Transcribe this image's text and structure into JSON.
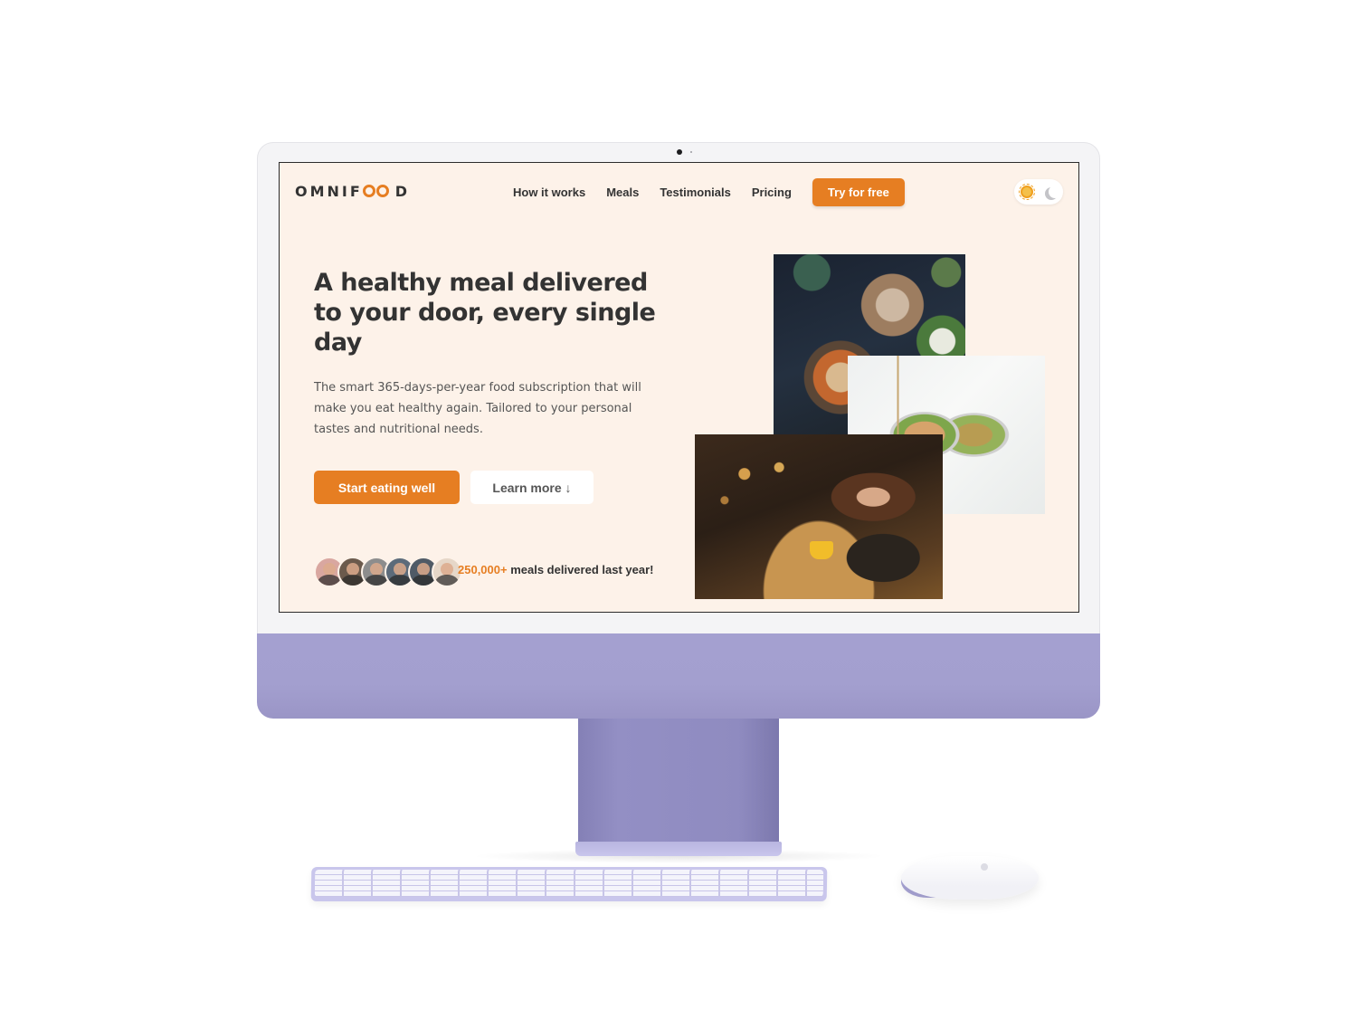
{
  "brand": {
    "logo_prefix": "OMNIF",
    "logo_suffix": "D",
    "accent_color": "#e67e22"
  },
  "nav": {
    "links": [
      "How it works",
      "Meals",
      "Testimonials",
      "Pricing"
    ],
    "cta": "Try for free"
  },
  "theme_toggle": {
    "light_icon": "sun-icon",
    "dark_icon": "moon-icon"
  },
  "hero": {
    "title": "A healthy meal delivered to your door, every single day",
    "description": "The smart 365-days-per-year food subscription that will make you eat healthy again. Tailored to your personal tastes and nutritional needs.",
    "primary_button": "Start eating well",
    "secondary_button": "Learn more ↓",
    "delivered_count": "250,000+",
    "delivered_text": " meals delivered last year!"
  },
  "avatars_count": 6
}
